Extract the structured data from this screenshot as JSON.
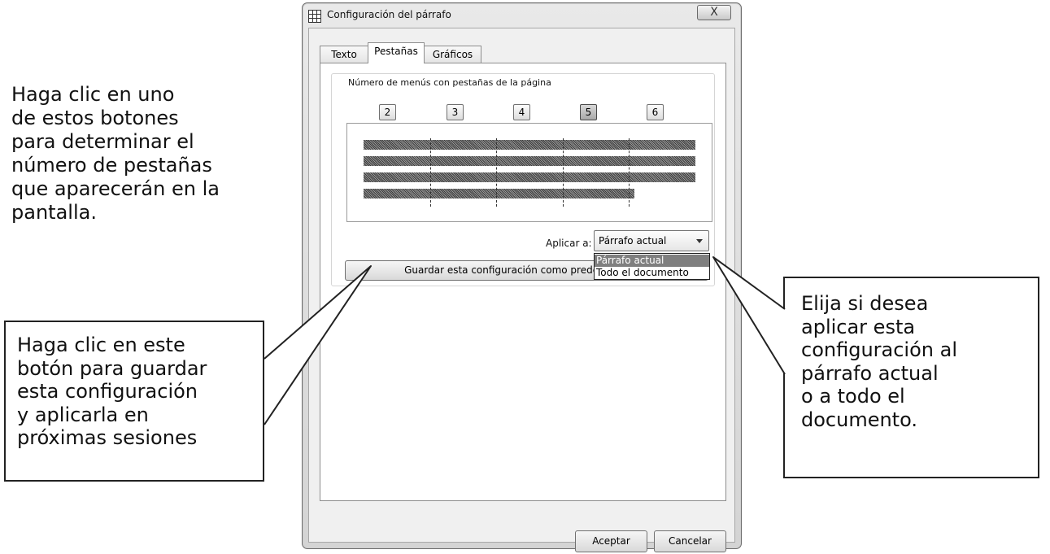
{
  "annotations": {
    "top_left": "Haga clic en uno\nde estos botones\npara determinar el\nnúmero de pestañas\nque aparecerán en la\npantalla.",
    "bottom_left": "Haga clic en este\nbotón para guardar\nesta configuración\ny aplicarla en\npróximas sesiones",
    "right": "Elija si desea\naplicar esta\nconfiguración al\npárrafo actual\no a todo el\ndocumento."
  },
  "dialog": {
    "title": "Configuración del párrafo",
    "close_label": "X",
    "tabs": [
      "Texto",
      "Pestañas",
      "Gráficos"
    ],
    "active_tab": "Pestañas",
    "group_label": "Número de menús con pestañas de la página",
    "tab_count_buttons": [
      "2",
      "3",
      "4",
      "5",
      "6"
    ],
    "selected_tab_count": "5",
    "apply_label": "Aplicar a:",
    "apply_value": "Párrafo actual",
    "apply_options": [
      "Párrafo actual",
      "Todo el documento"
    ],
    "save_button": "Guardar esta configuración como predeterminada",
    "ok_button": "Aceptar",
    "cancel_button": "Cancelar"
  },
  "icons": {
    "title_icon": "grid-icon",
    "dropdown_icon": "chevron-down-icon"
  }
}
